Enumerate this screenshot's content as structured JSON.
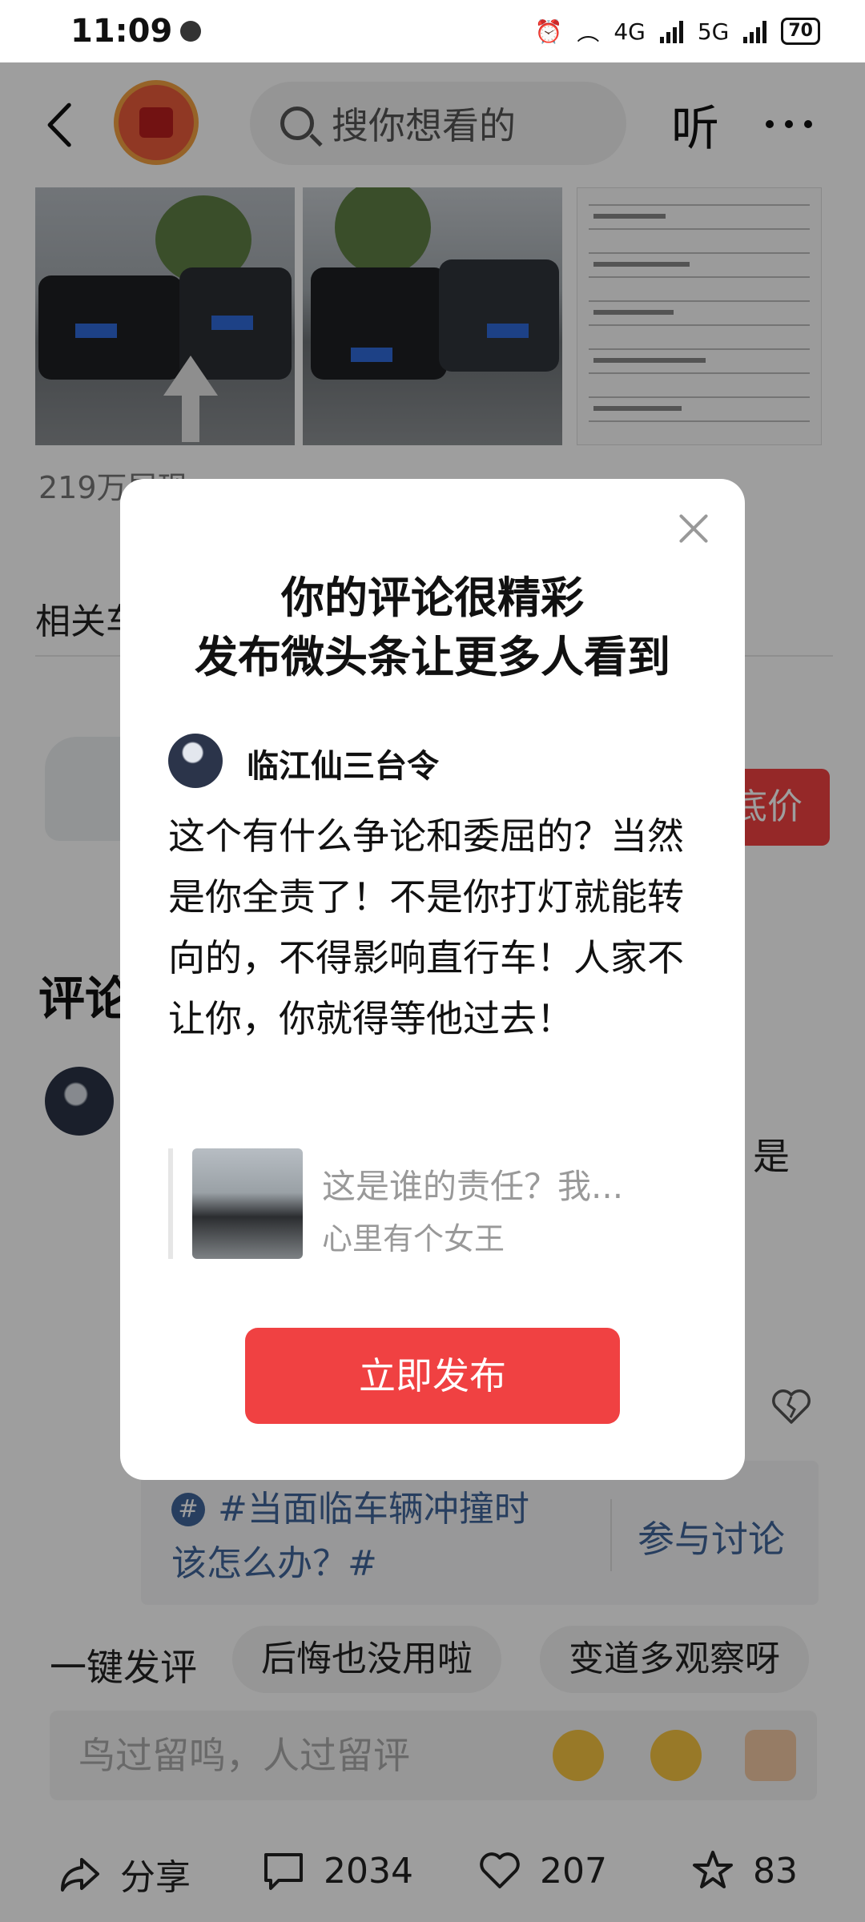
{
  "status_bar": {
    "time": "11:09",
    "net1": "4G",
    "net2": "5G",
    "battery": "70"
  },
  "header": {
    "search_placeholder": "搜你想看的",
    "listen_label": "听"
  },
  "article": {
    "views": "219万展现",
    "related_label": "相关车",
    "low_price_label": "底价",
    "comments_title": "评论",
    "bg_comment_fragment": "是"
  },
  "topic": {
    "hash_symbol": "#",
    "text_line1": "#当面临车辆冲撞时",
    "text_line2": "该怎么办？#",
    "join_label": "参与讨论"
  },
  "quick_reply": {
    "label": "一键发评",
    "chips": [
      "后悔也没用啦",
      "变道多观察呀"
    ],
    "input_placeholder": "鸟过留鸣，人过留评"
  },
  "bottom_bar": {
    "share_label": "分享",
    "comment_count": "2034",
    "like_count": "207",
    "fav_count": "83"
  },
  "modal": {
    "title_line1": "你的评论很精彩",
    "title_line2": "发布微头条让更多人看到",
    "username": "临江仙三台令",
    "comment_text": "这个有什么争论和委屈的？当然是你全责了！不是你打灯就能转向的，不得影响直行车！人家不让你，你就得等他过去！",
    "quote_title": "这是谁的责任？我...",
    "quote_author": "心里有个女王",
    "publish_button": "立即发布"
  },
  "colors": {
    "accent_red": "#f04142",
    "topic_blue": "#406599"
  }
}
